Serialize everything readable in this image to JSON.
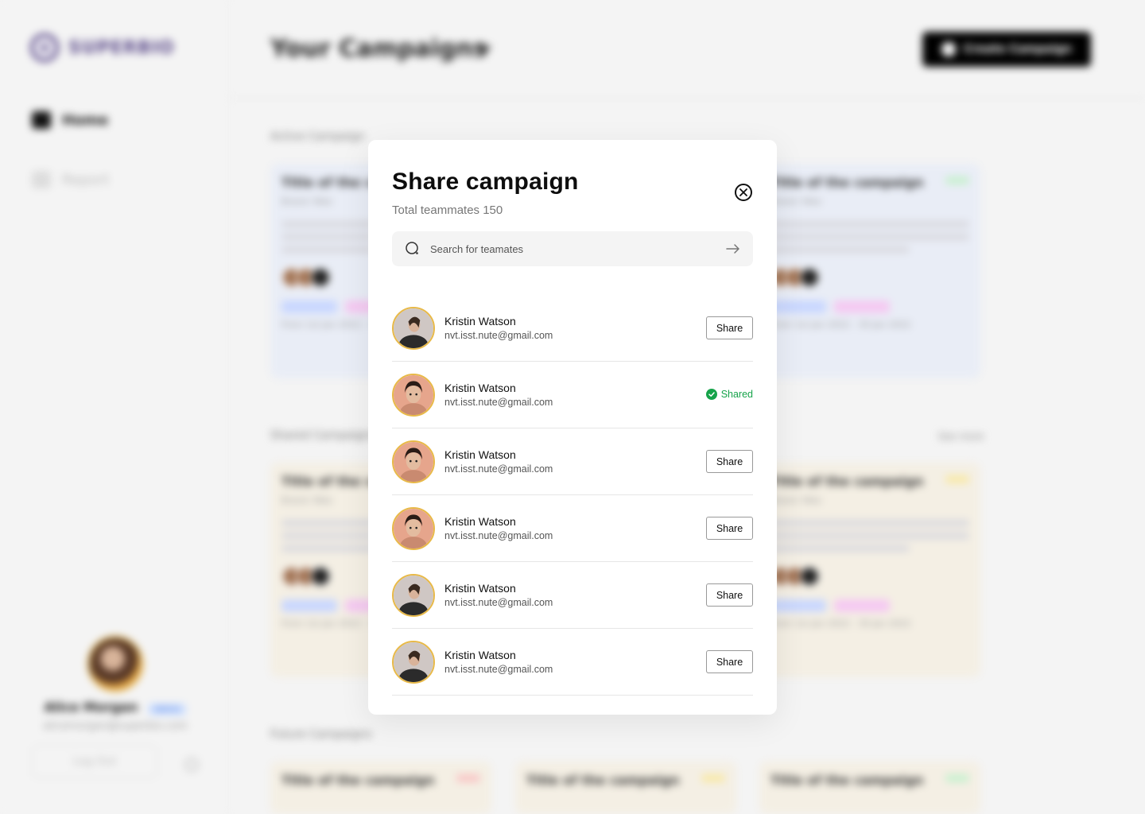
{
  "background": {
    "brand": "SUPERBIO",
    "nav": [
      "Home",
      "Report"
    ],
    "page_title": "Your Campaigns",
    "create_button": "Create Campaign",
    "sections": [
      "Active Campaign",
      "Shared Campaigns",
      "Future Campaigns"
    ],
    "see_more": "See more",
    "card_title": "Title of the campaign",
    "card_brand": "Brand: Nike",
    "card_groups": "5 Groups",
    "card_dates": "From 1st Jan 2022 - 30 Jan 2022",
    "profile": {
      "name": "Alice Morgan",
      "role": "Admin",
      "email": "alicemorgan@superbio.com",
      "logout": "Log Out"
    }
  },
  "modal": {
    "title": "Share campaign",
    "subtitle": "Total teammates 150",
    "search_placeholder": "Search for teamates",
    "teammates": [
      {
        "name": "Kristin Watson",
        "email": "nvt.isst.nute@gmail.com",
        "status": "Share"
      },
      {
        "name": "Kristin Watson",
        "email": "nvt.isst.nute@gmail.com",
        "status": "Shared"
      },
      {
        "name": "Kristin Watson",
        "email": "nvt.isst.nute@gmail.com",
        "status": "Share"
      },
      {
        "name": "Kristin Watson",
        "email": "nvt.isst.nute@gmail.com",
        "status": "Share"
      },
      {
        "name": "Kristin Watson",
        "email": "nvt.isst.nute@gmail.com",
        "status": "Share"
      },
      {
        "name": "Kristin Watson",
        "email": "nvt.isst.nute@gmail.com",
        "status": "Share"
      }
    ],
    "shared_color": "#16a34a",
    "avatar_border_color": "#e8b947"
  }
}
